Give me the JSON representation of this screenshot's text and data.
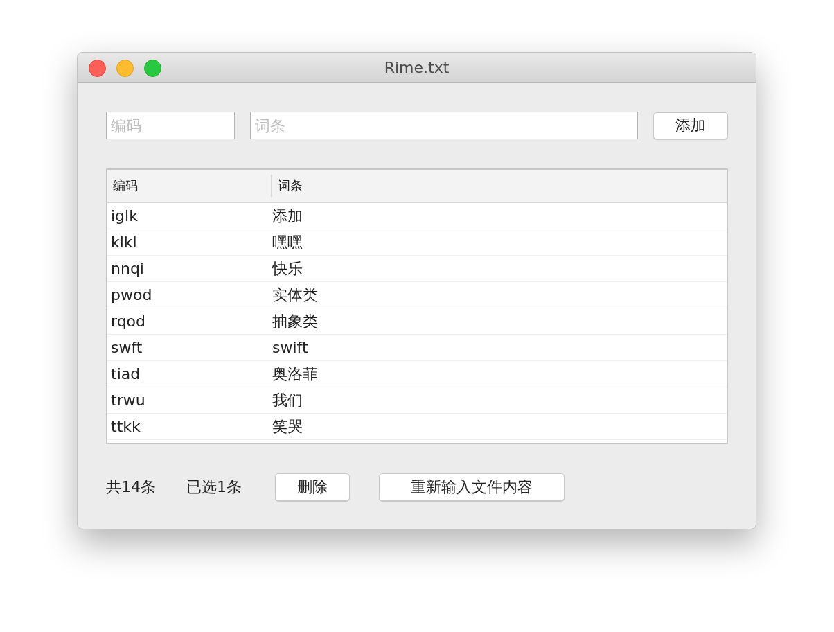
{
  "window": {
    "title": "Rime.txt"
  },
  "form": {
    "code_placeholder": "编码",
    "entry_placeholder": "词条",
    "add_button": "添加"
  },
  "table": {
    "columns": [
      "编码",
      "词条"
    ],
    "rows": [
      {
        "code": "iglk",
        "entry": "添加"
      },
      {
        "code": "klkl",
        "entry": "嘿嘿"
      },
      {
        "code": "nnqi",
        "entry": "快乐"
      },
      {
        "code": "pwod",
        "entry": "实体类"
      },
      {
        "code": "rqod",
        "entry": "抽象类"
      },
      {
        "code": "swft",
        "entry": "swift"
      },
      {
        "code": "tiad",
        "entry": "奥洛菲"
      },
      {
        "code": "trwu",
        "entry": "我们"
      },
      {
        "code": "ttkk",
        "entry": "笑哭"
      }
    ]
  },
  "footer": {
    "total": "共14条",
    "selected_count": "已选1条",
    "delete_button": "删除",
    "reload_button": "重新输入文件内容"
  }
}
